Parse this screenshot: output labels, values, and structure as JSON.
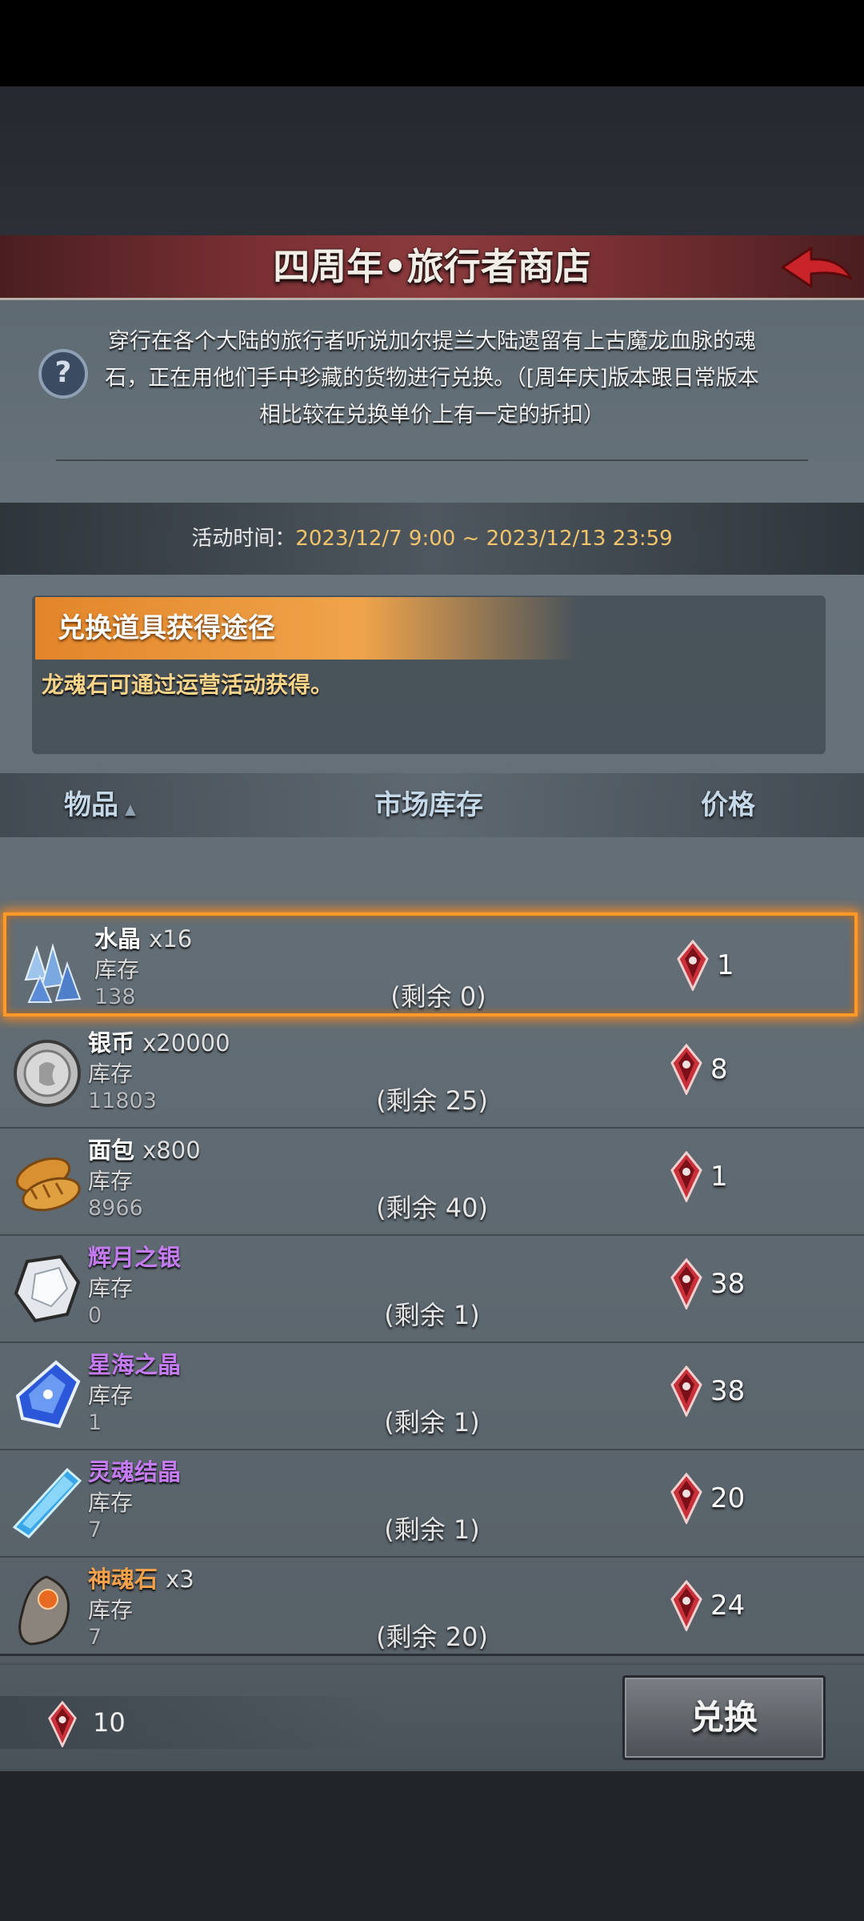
{
  "header": {
    "title": "四周年•旅行者商店"
  },
  "description": "穿行在各个大陆的旅行者听说加尔提兰大陆遗留有上古魔龙血脉的魂石，正在用他们手中珍藏的货物进行兑换。（[周年庆]版本跟日常版本相比较在兑换单价上有一定的折扣）",
  "event_time": {
    "label": "活动时间：",
    "value": "2023/12/7 9:00 ~ 2023/12/13 23:59"
  },
  "source": {
    "heading": "兑换道具获得途径",
    "text": "龙魂石可通过运营活动获得。"
  },
  "columns": {
    "item": "物品",
    "market_stock": "市场库存",
    "price": "价格"
  },
  "stock_label": "库存",
  "items": [
    {
      "name": "水晶",
      "qty": "x16",
      "stock": "138",
      "remaining": "(剩余 0)",
      "price": "1",
      "icon": "crystal-icon",
      "selected": true,
      "color": "#ffffff"
    },
    {
      "name": "银币",
      "qty": "x20000",
      "stock": "11803",
      "remaining": "(剩余 25)",
      "price": "8",
      "icon": "silver-coin-icon",
      "color": "#ffffff"
    },
    {
      "name": "面包",
      "qty": "x800",
      "stock": "8966",
      "remaining": "(剩余 40)",
      "price": "1",
      "icon": "bread-icon",
      "color": "#ffffff"
    },
    {
      "name": "辉月之银",
      "qty": "",
      "stock": "0",
      "remaining": "(剩余 1)",
      "price": "38",
      "icon": "moon-silver-icon",
      "color": "#c57bf2"
    },
    {
      "name": "星海之晶",
      "qty": "",
      "stock": "1",
      "remaining": "(剩余 1)",
      "price": "38",
      "icon": "star-sea-crystal-icon",
      "color": "#c57bf2"
    },
    {
      "name": "灵魂结晶",
      "qty": "",
      "stock": "7",
      "remaining": "(剩余 1)",
      "price": "20",
      "icon": "soul-crystal-icon",
      "color": "#c57bf2"
    },
    {
      "name": "神魂石",
      "qty": "x3",
      "stock": "7",
      "remaining": "(剩余 20)",
      "price": "24",
      "icon": "divine-soul-stone-icon",
      "color": "#f2a14a"
    }
  ],
  "footer": {
    "balance": "10",
    "exchange_label": "兑换"
  },
  "colors": {
    "accent_orange": "#f0a44a",
    "header_red": "#8a3a3c",
    "currency_red": "#c8303a"
  }
}
